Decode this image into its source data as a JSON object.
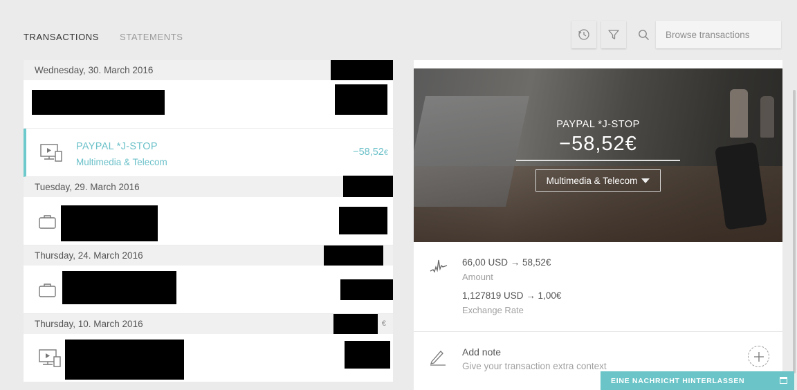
{
  "tabs": [
    {
      "label": "TRANSACTIONS",
      "active": true
    },
    {
      "label": "STATEMENTS",
      "active": false
    }
  ],
  "toolbar": {
    "search_placeholder": "Browse transactions",
    "icons": [
      "history-icon",
      "filter-icon",
      "search-icon"
    ]
  },
  "list": {
    "days": [
      {
        "date": "Wednesday, 30. March 2016"
      },
      {
        "date": "Tuesday, 29. March 2016"
      },
      {
        "date": "Thursday, 24. March 2016"
      },
      {
        "date": "Thursday, 10. March 2016",
        "suffix": "€"
      }
    ],
    "selected": {
      "name": "PAYPAL *J-STOP",
      "category": "Multimedia & Telecom",
      "amount": "−58,52",
      "currency": "€",
      "icon": "multimedia-icon"
    }
  },
  "detail": {
    "name": "PAYPAL *J-STOP",
    "amount": "−58,52€",
    "category": "Multimedia & Telecom",
    "amount_conversion": "66,00 USD → 58,52€",
    "amount_label": "Amount",
    "rate_conversion": "1,127819 USD → 1,00€",
    "rate_label": "Exchange Rate",
    "note_title": "Add note",
    "note_hint": "Give your transaction extra context"
  },
  "chat": {
    "label": "EINE NACHRICHT HINTERLASSEN"
  },
  "colors": {
    "accent": "#6cc1c9",
    "chat": "#6ac4c8"
  }
}
